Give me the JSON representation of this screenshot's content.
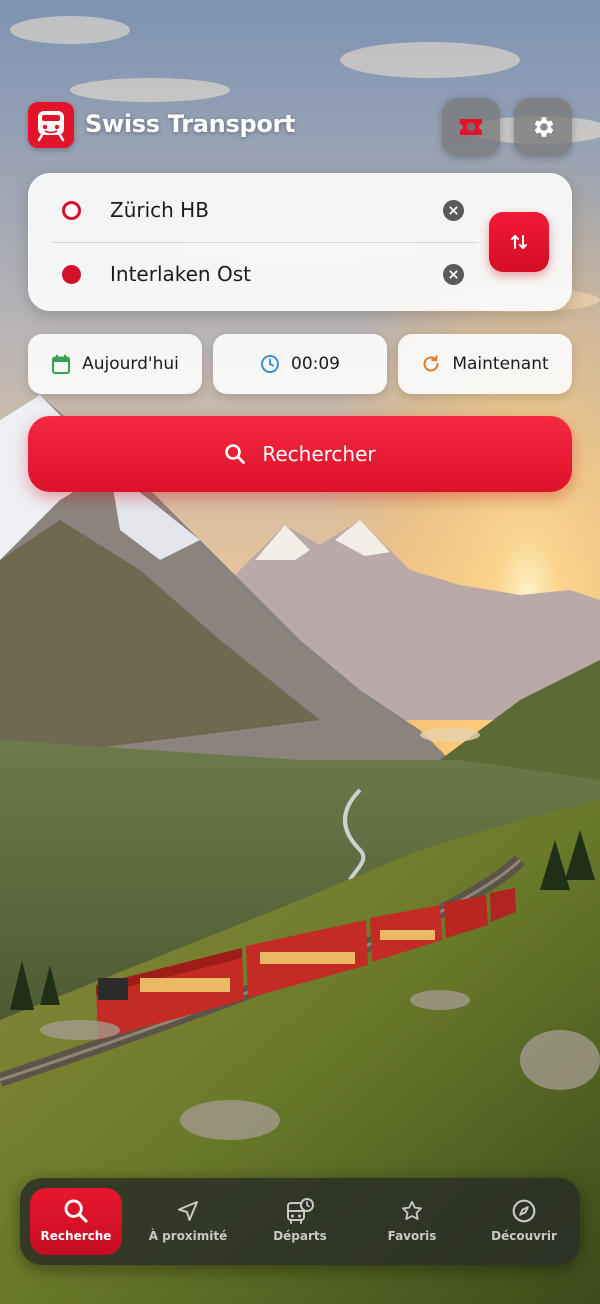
{
  "app": {
    "title": "Swiss Transport"
  },
  "route": {
    "from": "Zürich HB",
    "to": "Interlaken Ost"
  },
  "options": {
    "date_label": "Aujourd'hui",
    "time_label": "00:09",
    "now_label": "Maintenant"
  },
  "search": {
    "label": "Rechercher"
  },
  "nav": {
    "items": [
      {
        "label": "Recherche",
        "icon": "search-icon",
        "active": true
      },
      {
        "label": "À proximité",
        "icon": "location-arrow-icon",
        "active": false
      },
      {
        "label": "Départs",
        "icon": "bus-clock-icon",
        "active": false
      },
      {
        "label": "Favoris",
        "icon": "star-icon",
        "active": false
      },
      {
        "label": "Découvrir",
        "icon": "compass-icon",
        "active": false
      }
    ]
  },
  "colors": {
    "accent": "#e1142a",
    "card": "#fafafa",
    "nav_bg": "#2c2f28",
    "calendar_icon": "#3aa150",
    "clock_icon": "#3a8fd0",
    "refresh_icon": "#e07a2a"
  }
}
